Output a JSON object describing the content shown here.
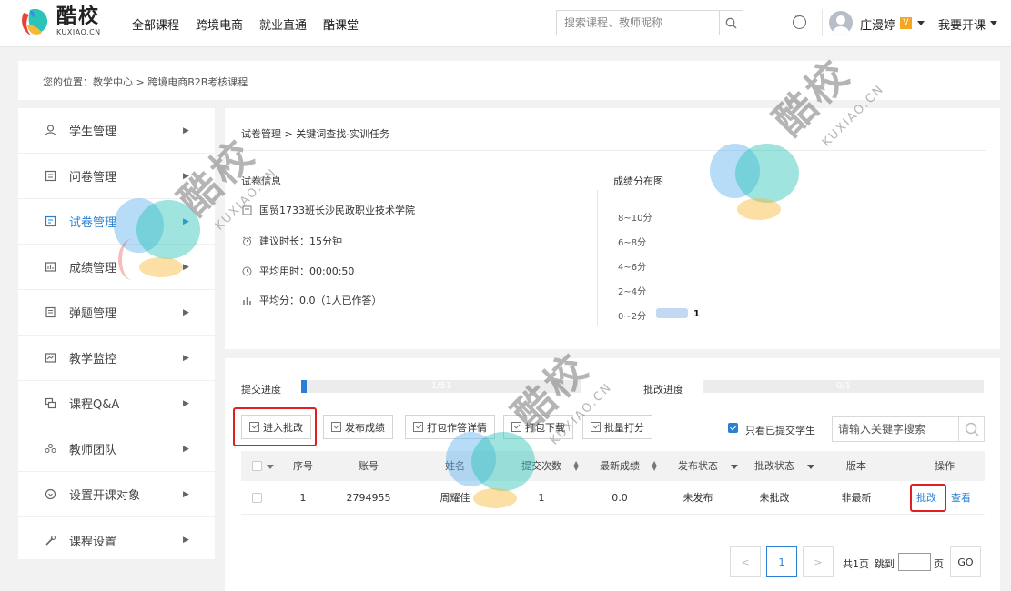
{
  "brand": {
    "name_cn": "酷校",
    "name_en": "KUXIAO.CN",
    "colors": {
      "accent": "#2a7fd4",
      "highlight": "#e02020",
      "progress_track": "#ececec",
      "dist_bar": "#c3d8f3"
    }
  },
  "nav": [
    "全部课程",
    "跨境电商",
    "就业直通",
    "酷课堂"
  ],
  "search": {
    "placeholder": "搜索课程、教师昵称"
  },
  "user": {
    "name": "庄漫婷",
    "open_course": "我要开课"
  },
  "breadcrumb": "您的位置：教学中心 > 跨境电商B2B考核课程",
  "sidebar": {
    "items": [
      {
        "label": "学生管理",
        "icon": "student-icon"
      },
      {
        "label": "问卷管理",
        "icon": "survey-icon"
      },
      {
        "label": "试卷管理",
        "icon": "exam-icon",
        "active": true
      },
      {
        "label": "成绩管理",
        "icon": "grade-icon"
      },
      {
        "label": "弹题管理",
        "icon": "popup-question-icon"
      },
      {
        "label": "教学监控",
        "icon": "monitor-icon"
      },
      {
        "label": "课程Q&A",
        "icon": "qa-icon"
      },
      {
        "label": "教师团队",
        "icon": "team-icon"
      },
      {
        "label": "设置开课对象",
        "icon": "target-icon"
      },
      {
        "label": "课程设置",
        "icon": "settings-icon"
      }
    ]
  },
  "info": {
    "title": "试卷管理 > 关键词查找-实训任务",
    "section_label": "试卷信息",
    "class_name": "国贸1733班长沙民政职业技术学院",
    "suggested_time": "建议时长：15分钟",
    "avg_time": "平均用时：00:00:50",
    "avg_score": "平均分：0.0（1人已作答）",
    "dist_title": "成绩分布图",
    "dist_ranges": [
      "8~10分",
      "6~8分",
      "4~6分",
      "2~4分",
      "0~2分"
    ],
    "dist_counts": [
      0,
      0,
      0,
      0,
      1
    ]
  },
  "progress": {
    "submit_label": "提交进度",
    "submit_text": "1/51",
    "submit_fraction": 0.0196,
    "review_label": "批改进度",
    "review_text": "0/1",
    "review_fraction": 0
  },
  "toolbar": {
    "enter_review": "进入批改",
    "publish_scores": "发布成绩",
    "print_details": "打包作答详情",
    "pack_download": "打包下载",
    "batch_score": "批量打分",
    "only_submitted": "只看已提交学生",
    "keyword_placeholder": "请输入关键字搜索"
  },
  "table": {
    "headers": [
      "序号",
      "账号",
      "姓名",
      "提交次数",
      "最新成绩",
      "发布状态",
      "批改状态",
      "版本",
      "操作"
    ],
    "rows": [
      {
        "index": "1",
        "account": "2794955",
        "name": "周耀佳",
        "submits": "1",
        "score": "0.0",
        "publish": "未发布",
        "review": "未批改",
        "version": "非最新",
        "action_review": "批改",
        "action_view": "查看"
      }
    ]
  },
  "pagination": {
    "prev": "<",
    "current": "1",
    "next": ">",
    "total": "共1页",
    "jump_label": "跳到",
    "page_unit": "页",
    "go": "GO"
  }
}
